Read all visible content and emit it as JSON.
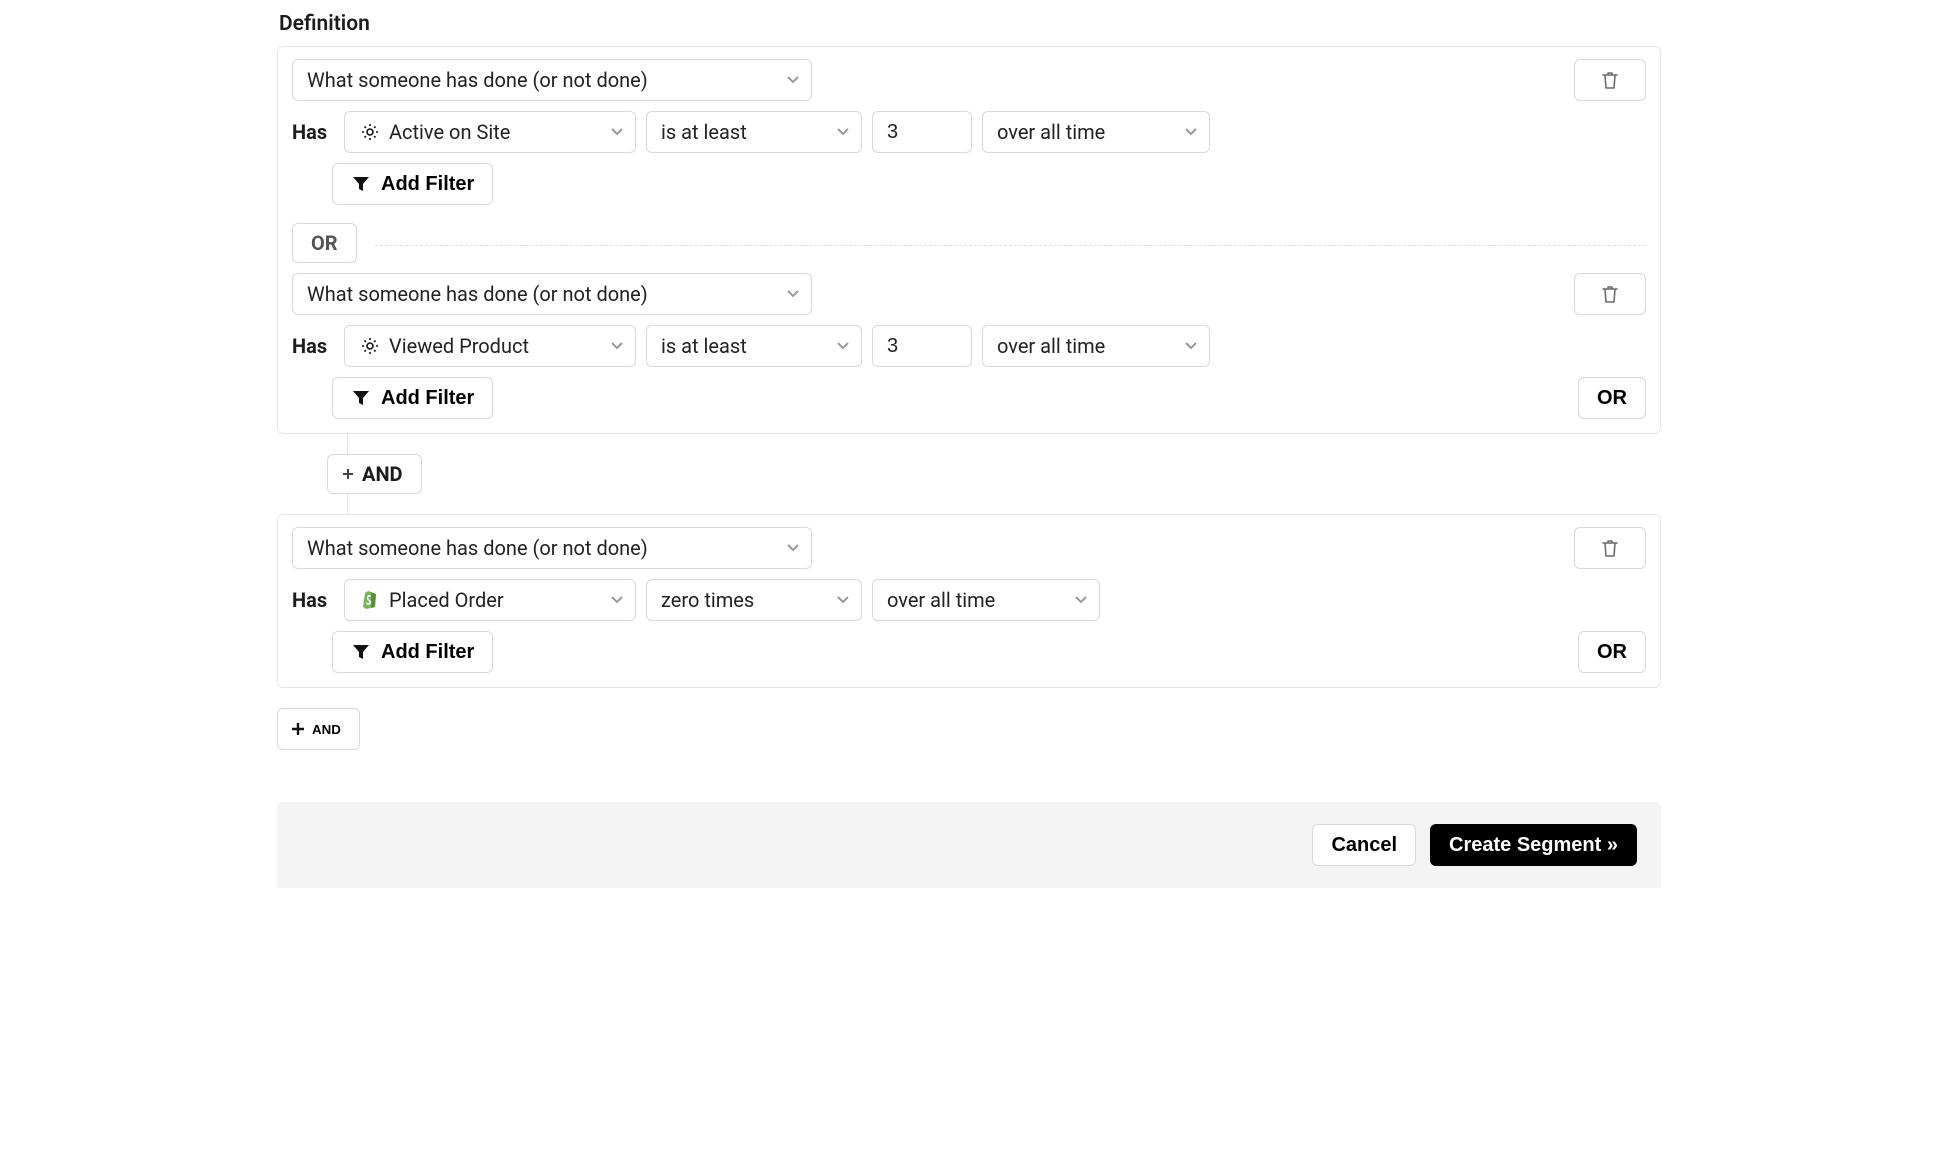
{
  "title": "Definition",
  "labels": {
    "has": "Has",
    "add_filter": "Add Filter",
    "or_chip": "OR",
    "and_chip": "AND",
    "or_button": "OR",
    "and_button": "AND",
    "cancel": "Cancel",
    "create_segment": "Create Segment »"
  },
  "condition_type": "What someone has done (or not done)",
  "groups": [
    {
      "blocks": [
        {
          "metric": "Active on Site",
          "icon": "gear",
          "operator": "is at least",
          "count": "3",
          "timeframe": "over all time",
          "show_count": true,
          "show_or_button": false
        },
        {
          "metric": "Viewed Product",
          "icon": "gear",
          "operator": "is at least",
          "count": "3",
          "timeframe": "over all time",
          "show_count": true,
          "show_or_button": true
        }
      ]
    },
    {
      "blocks": [
        {
          "metric": "Placed Order",
          "icon": "shopify",
          "operator": "zero times",
          "count": "",
          "timeframe": "over all time",
          "show_count": false,
          "show_or_button": true
        }
      ]
    }
  ]
}
